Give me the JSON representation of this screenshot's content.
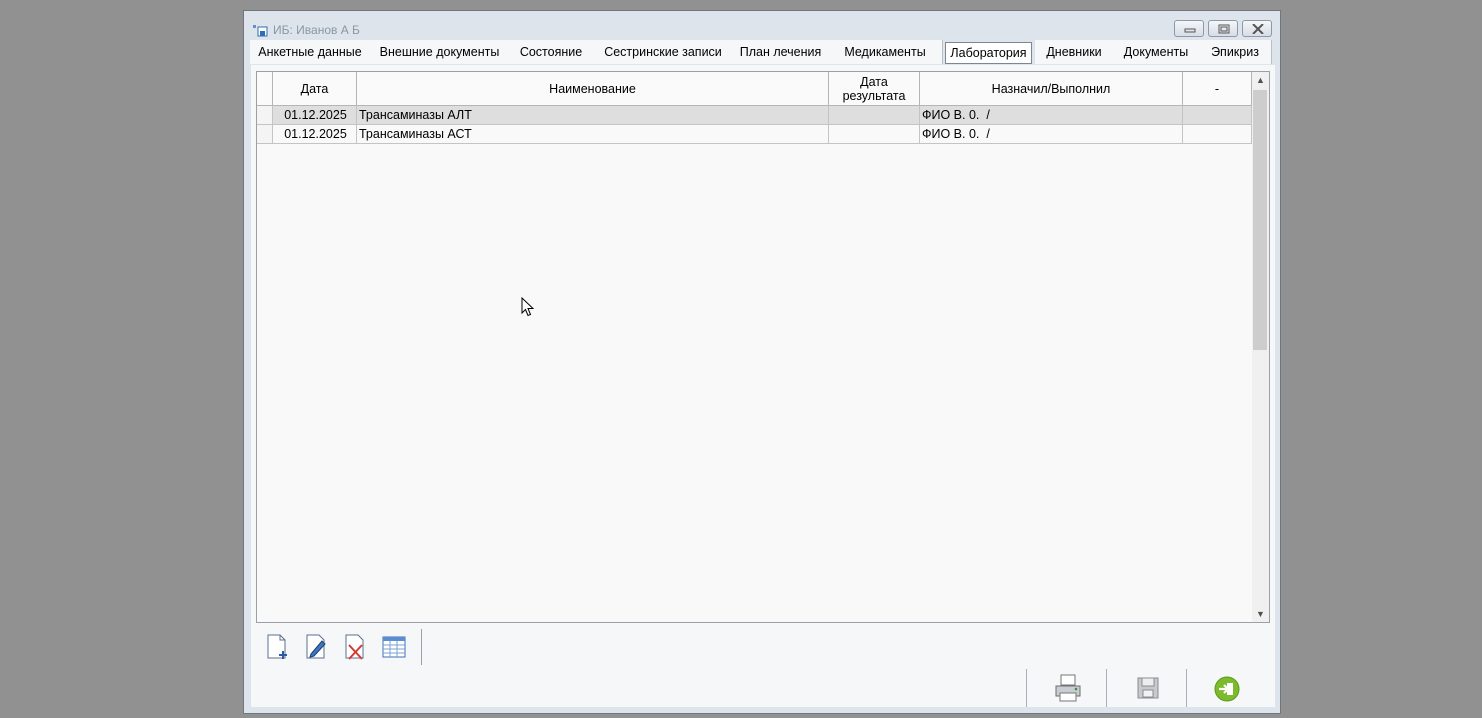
{
  "window": {
    "title": "ИБ: Иванов А Б"
  },
  "tabs": [
    "Анкетные данные",
    "Внешние документы",
    "Состояние",
    "Сестринские записи",
    "План лечения",
    "Медикаменты",
    "Лаборатория",
    "Дневники",
    "Документы",
    "Эпикриз"
  ],
  "active_tab": "Лаборатория",
  "table": {
    "columns": {
      "date": "Дата",
      "name": "Наименование",
      "result_date": "Дата\nрезультата",
      "assigned": "Назначил/Выполнил",
      "extra": "-"
    },
    "rows": [
      {
        "date": "01.12.2025",
        "name": "Трансаминазы АЛТ",
        "result_date": "",
        "assigned": "ФИО В. 0.  /",
        "extra": "",
        "selected": true
      },
      {
        "date": "01.12.2025",
        "name": "Трансаминазы АСТ",
        "result_date": "",
        "assigned": "ФИО В. 0.  /",
        "extra": "",
        "selected": false
      }
    ]
  },
  "toolbar": [
    "add-document-icon",
    "edit-document-icon",
    "delete-document-icon",
    "table-view-icon"
  ],
  "bottom_actions": [
    "printer-icon",
    "save-disk-icon",
    "exit-icon"
  ],
  "colors": {
    "accent_exit": "#7dbb2e",
    "selection": "#dedede",
    "window_frame": "#dde4ec"
  }
}
